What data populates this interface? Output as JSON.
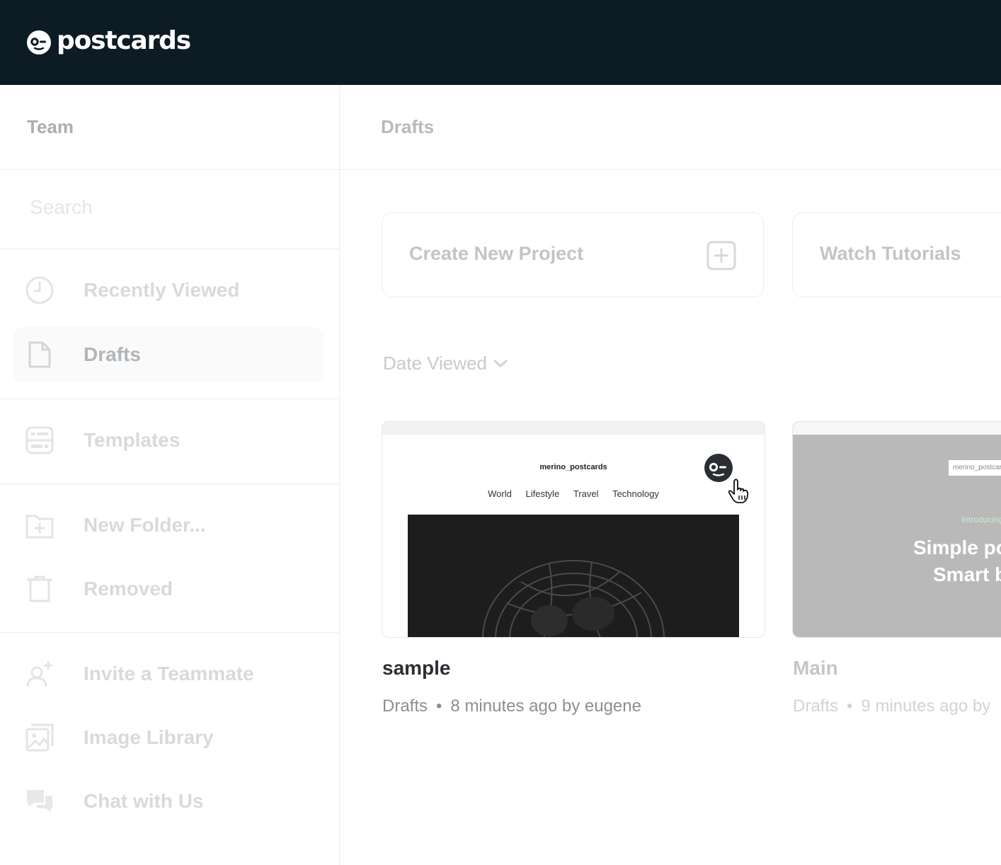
{
  "app": {
    "logo_text": "postcards"
  },
  "sidebar": {
    "team_label": "Team",
    "search_placeholder": "Search",
    "items": [
      {
        "label": "Recently Viewed",
        "icon": "clock-icon"
      },
      {
        "label": "Drafts",
        "icon": "document-icon",
        "active": true
      },
      {
        "label": "Templates",
        "icon": "templates-icon"
      },
      {
        "label": "New Folder...",
        "icon": "folder-plus-icon"
      },
      {
        "label": "Removed",
        "icon": "trash-icon"
      },
      {
        "label": "Invite a Teammate",
        "icon": "user-plus-icon"
      },
      {
        "label": "Image Library",
        "icon": "image-library-icon"
      },
      {
        "label": "Chat with Us",
        "icon": "chat-icon"
      }
    ]
  },
  "main": {
    "breadcrumb": "Drafts",
    "actions": [
      {
        "label": "Create New Project",
        "icon": "plus-square-icon"
      },
      {
        "label": "Watch Tutorials"
      }
    ],
    "sort_label": "Date Viewed",
    "projects": [
      {
        "title": "sample",
        "location": "Drafts",
        "meta": "8 minutes ago by eugene",
        "preview": {
          "brand": "merino_postcards",
          "nav": [
            "World",
            "Lifestyle",
            "Travel",
            "Technology"
          ]
        }
      },
      {
        "title": "Main",
        "location": "Drafts",
        "meta": "9 minutes ago by",
        "preview": {
          "brand": "merino_postcards",
          "intro": "Introducing",
          "headline_1": "Simple postcards",
          "headline_2": "Smart builder"
        }
      }
    ]
  },
  "colors": {
    "topbar": "#0d1b24",
    "title_dark": "#2b2f33",
    "muted": "#b6babe"
  }
}
